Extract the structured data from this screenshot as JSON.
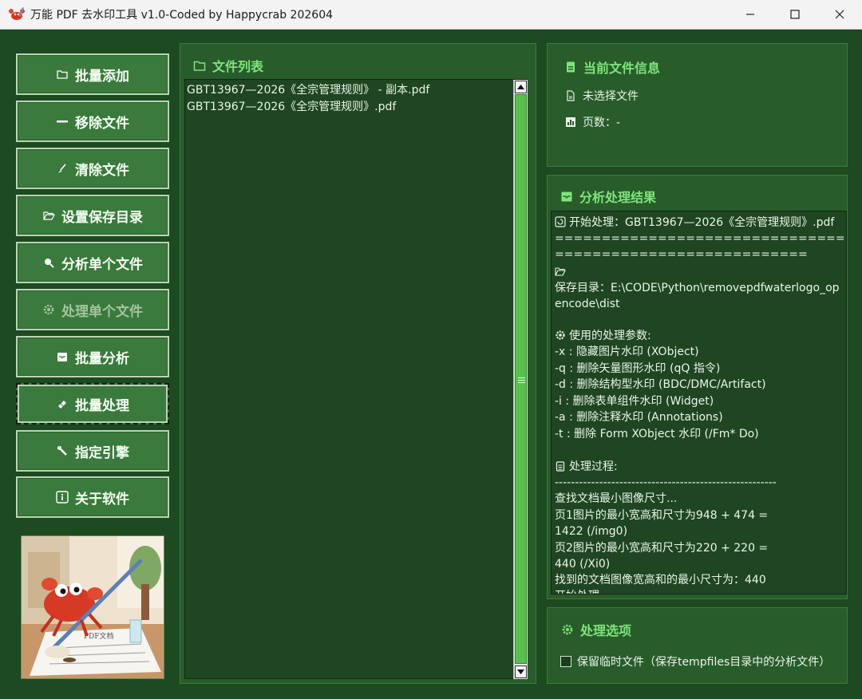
{
  "window": {
    "title": "万能 PDF 去水印工具 v1.0-Coded by Happycrab 202604"
  },
  "buttons": [
    {
      "label": "批量添加",
      "icon": "folder-icon"
    },
    {
      "label": "移除文件",
      "icon": "minus-icon"
    },
    {
      "label": "清除文件",
      "icon": "brush-icon"
    },
    {
      "label": "设置保存目录",
      "icon": "folder-open-icon"
    },
    {
      "label": "分析单个文件",
      "icon": "magnifier-icon"
    },
    {
      "label": "处理单个文件",
      "icon": "gear-icon"
    },
    {
      "label": "批量分析",
      "icon": "inbox-icon"
    },
    {
      "label": "批量处理",
      "icon": "eraser-icon"
    },
    {
      "label": "指定引擎",
      "icon": "wrench-icon"
    },
    {
      "label": "关于软件",
      "icon": "info-icon"
    }
  ],
  "file_list": {
    "title": "文件列表",
    "items": [
      "GBT13967—2026《全宗管理规则》 - 副本.pdf",
      "GBT13967—2026《全宗管理规则》.pdf"
    ]
  },
  "file_info": {
    "title": "当前文件信息",
    "file": "未选择文件",
    "pages": "页数：-"
  },
  "result": {
    "title": "分析处理结果",
    "lines": [
      "开始处理：GBT13967—2026《全宗管理规则》.pdf",
      "=====================================",
      "===========================",
      "",
      "保存目录：E:\\CODE\\Python\\removepdfwaterlogo_op",
      "encode\\dist",
      "",
      "使用的处理参数:",
      "  -x : 隐藏图片水印 (XObject)",
      "  -q : 删除矢量图形水印 (qQ 指令)",
      "  -d : 删除结构型水印 (BDC/DMC/Artifact)",
      "  -i : 删除表单组件水印 (Widget)",
      "  -a : 删除注释水印 (Annotations)",
      "  -t : 删除 Form XObject 水印 (/Fm* Do)",
      "",
      "处理过程:",
      "-------------------------------------------------------",
      "  查找文档最小图像尺寸...",
      "  页1图片的最小宽高和尺寸为948 + 474 =",
      "1422  (/img0)",
      "  页2图片的最小宽高和尺寸为220 + 220 =",
      "440  (/Xi0)",
      "  找到的文档图像宽高和的最小尺寸为：440",
      "  开始处理..."
    ]
  },
  "options": {
    "title": "处理选项",
    "keep_temp_label": "保留临时文件（保存tempfiles目录中的分析文件）",
    "keep_temp_checked": false
  },
  "image": {
    "sign_text": "PDF文档"
  },
  "colors": {
    "accent": "#7ee57b",
    "button_bg": "#3a7a3c",
    "panel_bg": "#295c2b",
    "scroll_thumb": "#56c24c"
  }
}
